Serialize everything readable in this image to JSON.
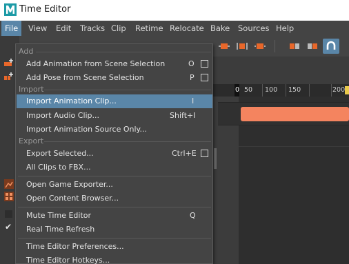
{
  "window": {
    "title": "Time Editor"
  },
  "menubar": {
    "items": [
      "File",
      "View",
      "Edit",
      "Tracks",
      "Clip",
      "Retime",
      "Relocate",
      "Bake",
      "Sources",
      "Help"
    ],
    "active": "File"
  },
  "ruler": {
    "playhead": "0",
    "ticks": [
      "0",
      "50",
      "100",
      "150",
      "200"
    ]
  },
  "clip": {
    "color": "#f4845f"
  },
  "file_menu": {
    "add_header": "Add",
    "add_animation": {
      "label": "Add Animation from Scene Selection",
      "shortcut": "O"
    },
    "add_pose": {
      "label": "Add Pose from Scene Selection",
      "shortcut": "P"
    },
    "import_header": "Import",
    "import_clip": {
      "label": "Import Animation Clip...",
      "shortcut": "I"
    },
    "import_audio": {
      "label": "Import Audio Clip...",
      "shortcut": "Shift+I"
    },
    "import_source": {
      "label": "Import Animation Source Only..."
    },
    "export_header": "Export",
    "export_selected": {
      "label": "Export Selected...",
      "shortcut": "Ctrl+E"
    },
    "clips_fbx": {
      "label": "All Clips to FBX..."
    },
    "game_exporter": {
      "label": "Open Game Exporter..."
    },
    "content_browser": {
      "label": "Open Content Browser..."
    },
    "mute": {
      "label": "Mute Time Editor",
      "shortcut": "Q"
    },
    "realtime": {
      "label": "Real Time Refresh"
    },
    "preferences": {
      "label": "Time Editor Preferences..."
    },
    "hotkeys": {
      "label": "Time Editor Hotkeys..."
    }
  },
  "colors": {
    "highlight": "#5a86a8",
    "accent": "#e8672a"
  }
}
